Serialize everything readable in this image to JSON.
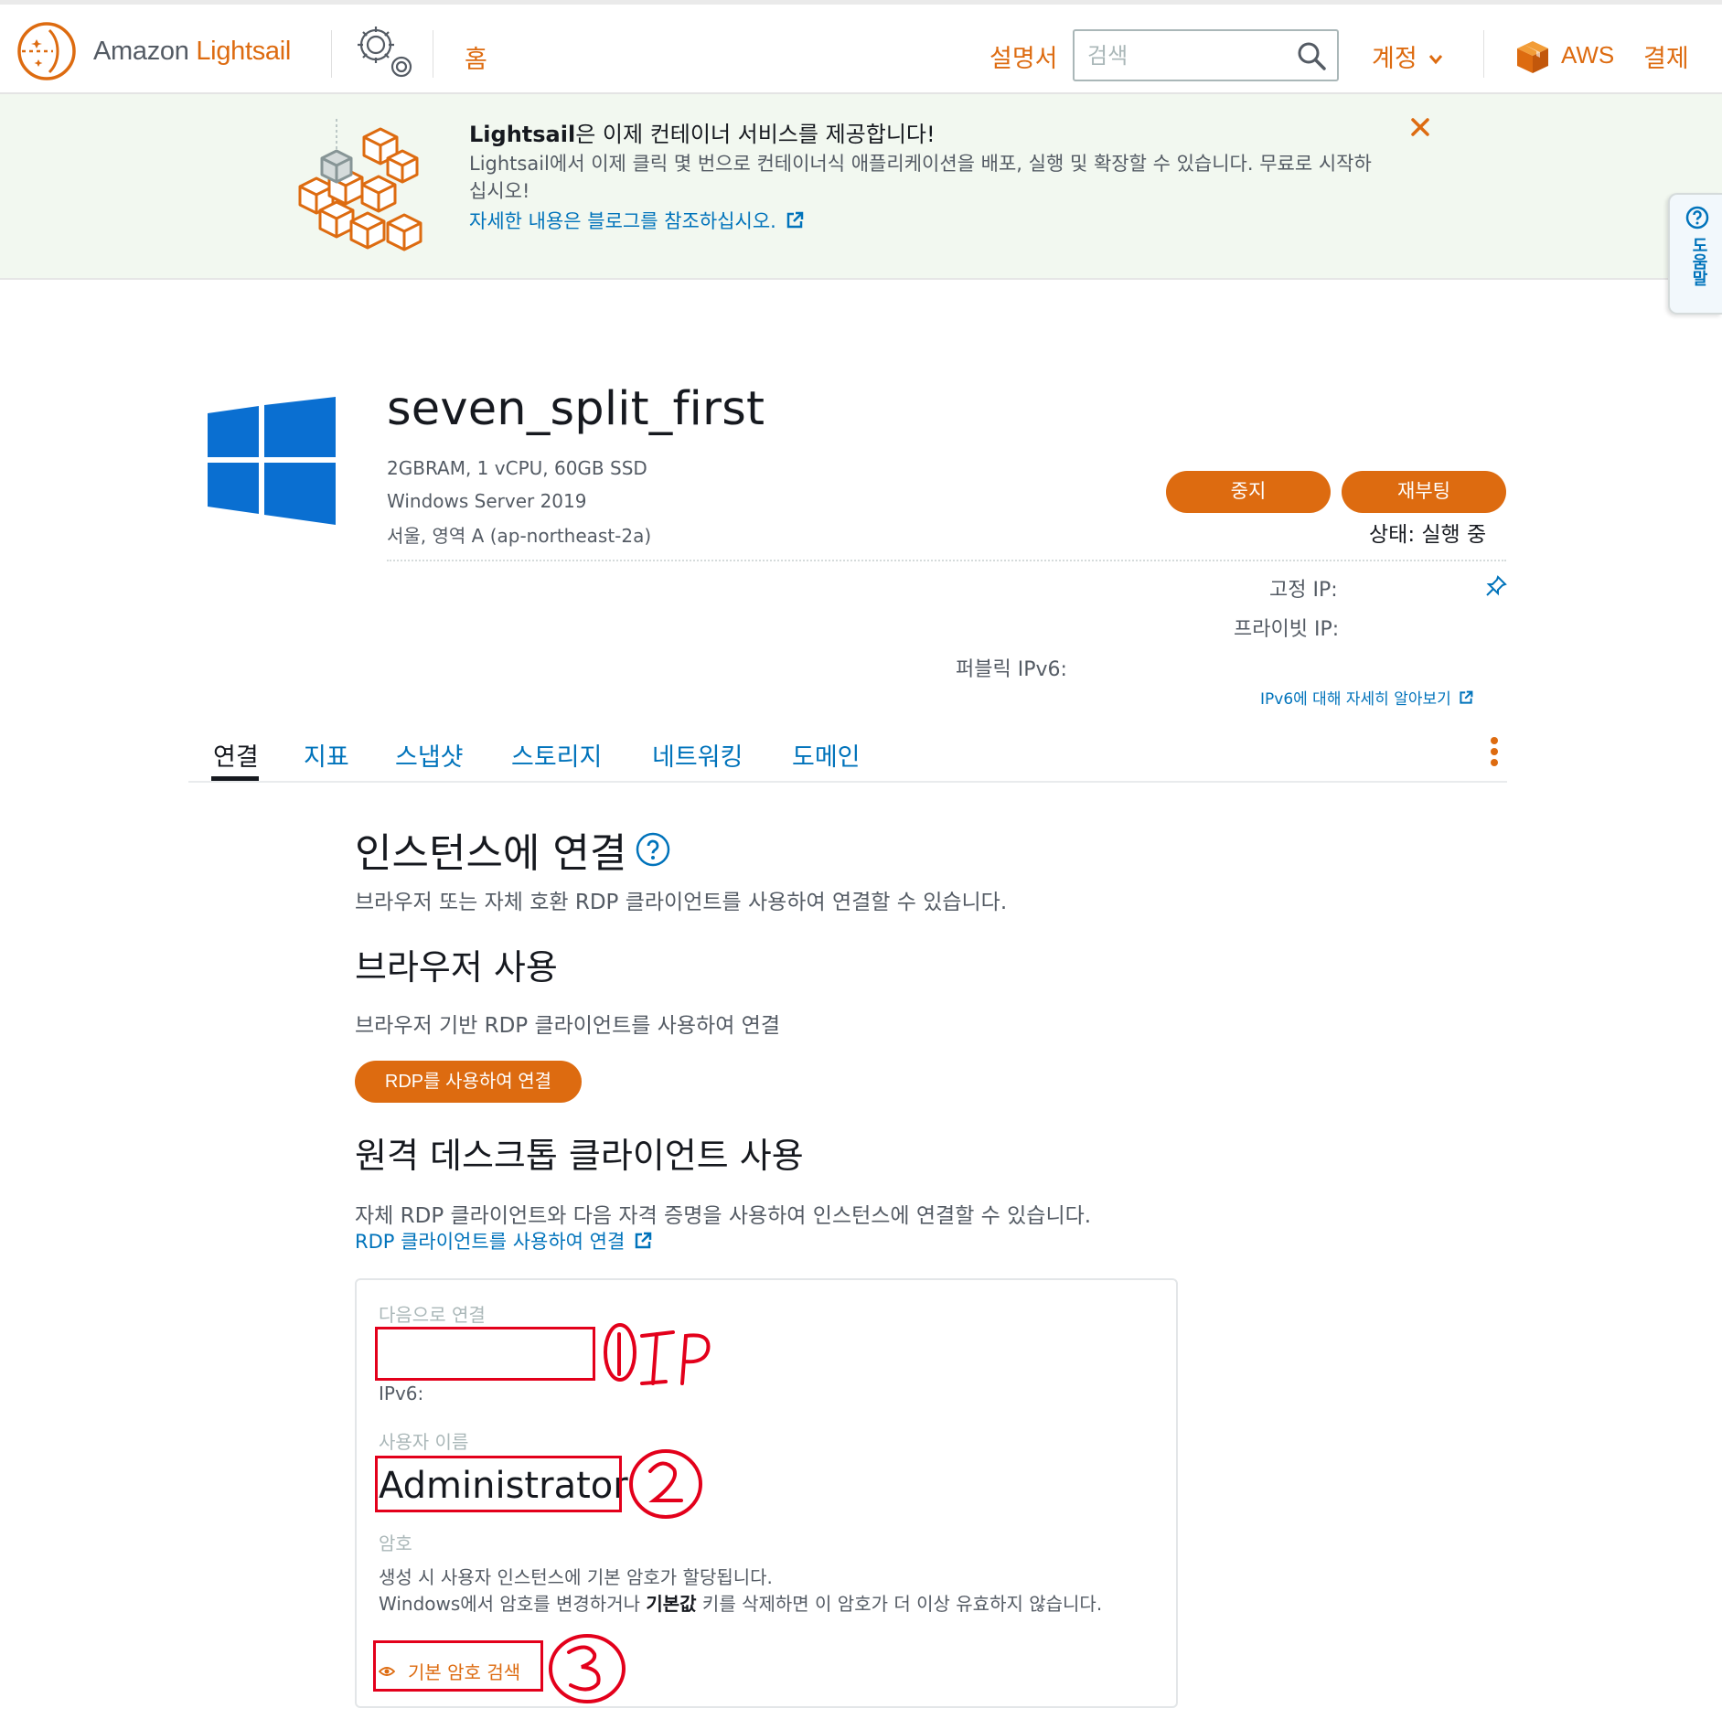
{
  "header": {
    "brand_prefix": "Amazon ",
    "brand_name": "Lightsail",
    "home": "홈",
    "docs": "설명서",
    "search_placeholder": "검색",
    "account": "계정",
    "aws": "AWS",
    "billing": "결제"
  },
  "banner": {
    "title_bold": "Lightsail",
    "title_rest": "은 이제 컨테이너 서비스를 제공합니다!",
    "body": "Lightsail에서 이제 클릭 몇 번으로 컨테이너식 애플리케이션을 배포, 실행 및 확장할 수 있습니다. 무료로 시작하십시오!",
    "link": "자세한 내용은 블로그를 참조하십시오."
  },
  "help_tab": "도움말",
  "instance": {
    "name": "seven_split_first",
    "spec": "2GBRAM, 1 vCPU, 60GB SSD",
    "os": "Windows Server 2019",
    "region": "서울, 영역 A (ap-northeast-2a)",
    "stop": "중지",
    "reboot": "재부팅",
    "status_label": "상태: ",
    "status_value": "실행 중",
    "static_ip": "고정 IP:",
    "private_ip": "프라이빗 IP:",
    "public_ipv6": "퍼블릭 IPv6:",
    "ipv6_learn": "IPv6에 대해 자세히 알아보기"
  },
  "tabs": [
    "연결",
    "지표",
    "스냅샷",
    "스토리지",
    "네트워킹",
    "도메인"
  ],
  "content": {
    "connect_title": "인스턴스에 연결",
    "connect_desc": "브라우저 또는 자체 호환 RDP 클라이언트를 사용하여 연결할 수 있습니다.",
    "browser_title": "브라우저 사용",
    "browser_desc": "브라우저 기반 RDP 클라이언트를 사용하여 연결",
    "rdp_button": "RDP를 사용하여 연결",
    "client_title": "원격 데스크톱 클라이언트 사용",
    "client_desc": "자체 RDP 클라이언트와 다음 자격 증명을 사용하여 인스턴스에 연결할 수 있습니다.",
    "client_link": "RDP 클라이언트를 사용하여 연결"
  },
  "card": {
    "connect_to": "다음으로 연결",
    "ipv6": "IPv6:",
    "username_label": "사용자 이름",
    "username": "Administrator",
    "password_label": "암호",
    "pw_line1": "생성 시 사용자 인스턴스에 기본 암호가 할당됩니다.",
    "pw_line2_a": "Windows에서 암호를 변경하거나 ",
    "pw_line2_b": "기본값",
    "pw_line2_c": " 키를 삭제하면 이 암호가 더 이상 유효하지 않습니다.",
    "get_password": "기본 암호 검색"
  },
  "colors": {
    "accent": "#dd6b10",
    "link": "#0073bb",
    "annotation": "#e3001b"
  }
}
